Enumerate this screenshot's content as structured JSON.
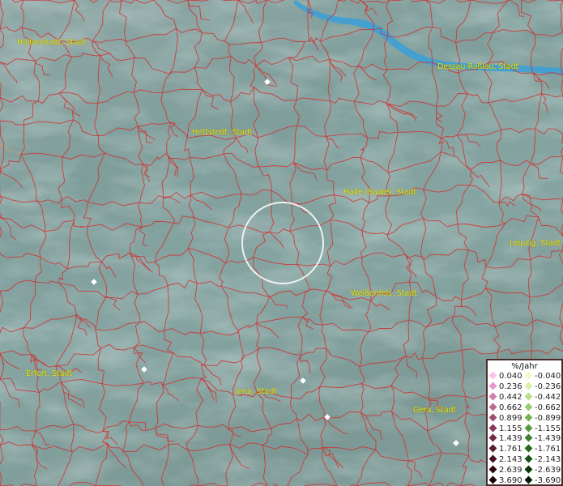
{
  "map": {
    "cities": [
      {
        "label": "Halberstadt, Stadt",
        "slot": "c1"
      },
      {
        "label": "Dessau-Roßlau, Stadt",
        "slot": "c2"
      },
      {
        "label": "Hettstedt, Stadt",
        "slot": "c3"
      },
      {
        "label": "Halle (Saale), Stadt",
        "slot": "c4"
      },
      {
        "label": "Leipzig, Stadt",
        "slot": "c5"
      },
      {
        "label": "Weißenfels, Stadt",
        "slot": "c6"
      },
      {
        "label": "Erfurt, Stadt",
        "slot": "c7"
      },
      {
        "label": "Jena, Stadt",
        "slot": "c8"
      },
      {
        "label": "Gera, Stadt",
        "slot": "c9"
      }
    ],
    "colors": {
      "boundary": "#d42a2a",
      "river": "#3aa0d8",
      "city_label": "#e8e61c",
      "selection_circle": "#ffffff"
    }
  },
  "legend": {
    "title": "%/Jahr",
    "positive": [
      {
        "label": "0.040",
        "color": "#f7c3ec"
      },
      {
        "label": "0.236",
        "color": "#e89acd"
      },
      {
        "label": "0.442",
        "color": "#cf7fa9"
      },
      {
        "label": "0.662",
        "color": "#b96a8f"
      },
      {
        "label": "0.899",
        "color": "#9e4f71"
      },
      {
        "label": "1.155",
        "color": "#8a3a5a"
      },
      {
        "label": "1.439",
        "color": "#722a45"
      },
      {
        "label": "1.761",
        "color": "#5a1c33"
      },
      {
        "label": "2.143",
        "color": "#451223"
      },
      {
        "label": "2.639",
        "color": "#2f0a16"
      },
      {
        "label": "3.690",
        "color": "#1a0309"
      }
    ],
    "negative": [
      {
        "label": "-0.040",
        "color": "#eefbc3"
      },
      {
        "label": "-0.236",
        "color": "#d6f0a6"
      },
      {
        "label": "-0.442",
        "color": "#b9e08a"
      },
      {
        "label": "-0.662",
        "color": "#97cc6d"
      },
      {
        "label": "-0.899",
        "color": "#74b354"
      },
      {
        "label": "-1.155",
        "color": "#559a3e"
      },
      {
        "label": "-1.439",
        "color": "#3d812c"
      },
      {
        "label": "-1.761",
        "color": "#28681e"
      },
      {
        "label": "-2.143",
        "color": "#175013"
      },
      {
        "label": "-2.639",
        "color": "#0b380a"
      },
      {
        "label": "-3.690",
        "color": "#031f03"
      }
    ]
  }
}
